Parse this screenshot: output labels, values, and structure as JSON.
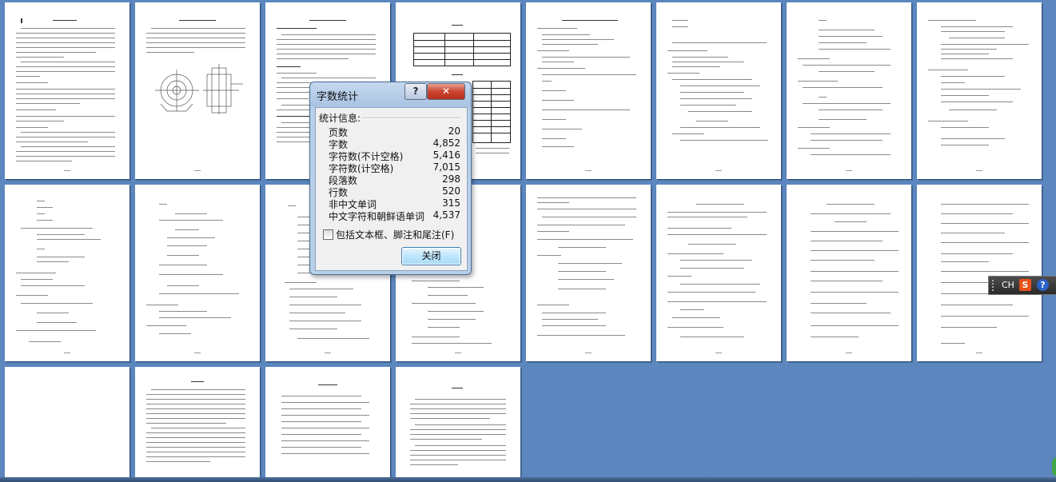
{
  "dialog": {
    "title": "字数统计",
    "help_glyph": "?",
    "close_glyph": "✕",
    "group_label": "统计信息:",
    "stats": [
      {
        "label": "页数",
        "value": "20"
      },
      {
        "label": "字数",
        "value": "4,852"
      },
      {
        "label": "字符数(不计空格)",
        "value": "5,416"
      },
      {
        "label": "字符数(计空格)",
        "value": "7,015"
      },
      {
        "label": "段落数",
        "value": "298"
      },
      {
        "label": "行数",
        "value": "520"
      },
      {
        "label": "非中文单词",
        "value": "315"
      },
      {
        "label": "中文字符和朝鲜语单词",
        "value": "4,537"
      }
    ],
    "checkbox_label": "包括文本框、脚注和尾注(F)",
    "checkbox_checked": false,
    "close_button": "关闭"
  },
  "ime": {
    "mode": "CH",
    "logo": "S",
    "help": "?"
  },
  "document": {
    "page_count_visible": 20
  }
}
